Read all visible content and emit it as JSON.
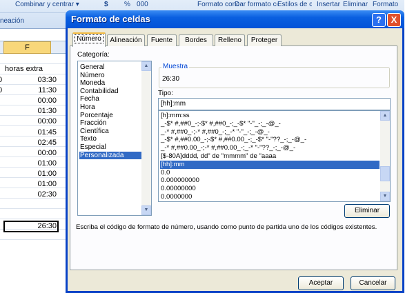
{
  "ribbon": {
    "merge_center": "Combinar y centrar ▾",
    "currency": "$",
    "percent": "%",
    "thousands": "000",
    "conditional_format": "Formato condicional",
    "format_as_table": "Dar formato como tabla",
    "cell_styles": "Estilos de celda",
    "insert": "Insertar",
    "delete": "Eliminar",
    "format": "Formato",
    "group_alignment": "neación"
  },
  "sheet": {
    "column_header": "F",
    "header_cell": "horas extra",
    "left_fragments": [
      "0",
      "0"
    ],
    "values": [
      "03:30",
      "11:30",
      "00:00",
      "01:30",
      "00:00",
      "01:45",
      "02:45",
      "00:00",
      "01:00",
      "01:00",
      "01:00",
      "02:30"
    ],
    "total": "26:30"
  },
  "dialog": {
    "title": "Formato de celdas",
    "help": "?",
    "close": "X",
    "tabs": [
      "Número",
      "Alineación",
      "Fuente",
      "Bordes",
      "Relleno",
      "Proteger"
    ],
    "active_tab": "Número",
    "category_label": "Categoría:",
    "categories": [
      "General",
      "Número",
      "Moneda",
      "Contabilidad",
      "Fecha",
      "Hora",
      "Porcentaje",
      "Fracción",
      "Científica",
      "Texto",
      "Especial",
      "Personalizada"
    ],
    "selected_category": "Personalizada",
    "sample_label": "Muestra",
    "sample_value": "26:30",
    "type_label": "Tipo:",
    "type_value": "[hh]:mm",
    "codes": [
      "[h]:mm:ss",
      "_-$* #,##0_-;-$* #,##0_-;_-$* \"-\"_-;_-@_-",
      "_-* #,##0_-;-* #,##0_-;_-* \"-\"_-;_-@_-",
      "_-$* #,##0.00_-;-$* #,##0.00_-;_-$* \"-\"??_-;_-@_-",
      "_-* #,##0.00_-;-* #,##0.00_-;_-* \"-\"??_-;_-@_-",
      "[$-80A]dddd, dd\" de \"mmmm\" de \"aaaa",
      "[hh]:mm",
      "0.0",
      "0.000000000",
      "0.00000000",
      "0.0000000"
    ],
    "selected_code": "[hh]:mm",
    "delete_button": "Eliminar",
    "description": "Escriba el código de formato de número, usando como punto de partida uno de los códigos existentes.",
    "ok_button": "Aceptar",
    "cancel_button": "Cancelar"
  }
}
